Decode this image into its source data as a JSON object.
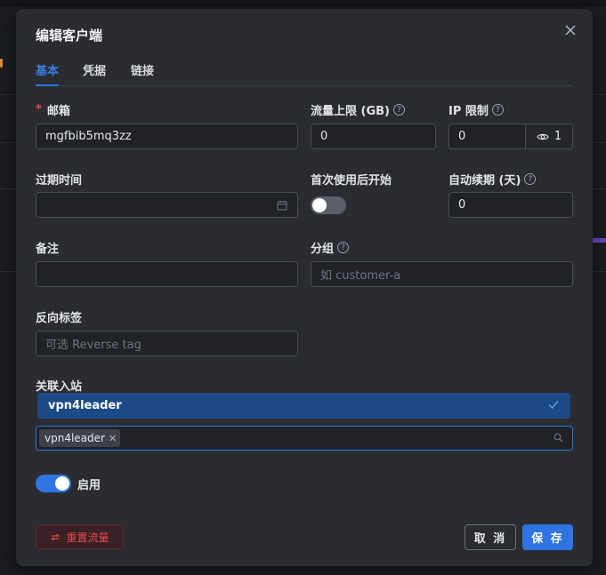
{
  "modal": {
    "title": "编辑客户端"
  },
  "tabs": [
    {
      "label": "基本",
      "active": true
    },
    {
      "label": "凭据",
      "active": false
    },
    {
      "label": "链接",
      "active": false
    }
  ],
  "fields": {
    "email": {
      "label": "邮箱",
      "required": true,
      "value": "mgfbib5mq3zz"
    },
    "traffic_limit": {
      "label": "流量上限 (GB)",
      "value": "0"
    },
    "ip_limit": {
      "label": "IP 限制",
      "value": "0",
      "online_count": "1"
    },
    "expiry": {
      "label": "过期时间",
      "value": ""
    },
    "start_on_first_use": {
      "label": "首次使用后开始",
      "enabled": false
    },
    "auto_renew": {
      "label": "自动续期 (天)",
      "value": "0"
    },
    "remark": {
      "label": "备注",
      "value": ""
    },
    "group": {
      "label": "分组",
      "placeholder": "如 customer-a"
    },
    "reverse_tag": {
      "label": "反向标签",
      "placeholder": "可选 Reverse tag"
    },
    "inbounds": {
      "label": "关联入站",
      "dropdown_option": "vpn4leader",
      "selected": [
        "vpn4leader"
      ]
    },
    "enable": {
      "label": "启用",
      "enabled": true
    }
  },
  "footer": {
    "reset_label": "重置流量",
    "cancel_label": "取 消",
    "save_label": "保 存"
  },
  "colors": {
    "accent": "#2f74e0",
    "danger": "#e5484d",
    "surface": "#2a2c32"
  }
}
